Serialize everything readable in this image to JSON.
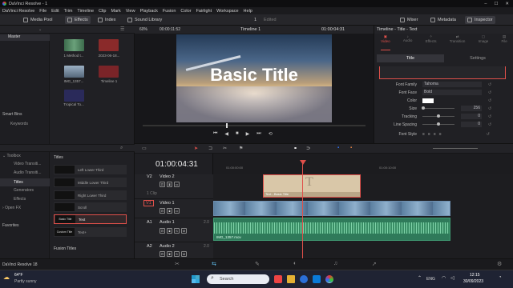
{
  "window": {
    "title": "DaVinci Resolve - 1",
    "controls": [
      "–",
      "☐",
      "✕"
    ]
  },
  "menu": [
    "DaVinci Resolve",
    "File",
    "Edit",
    "Trim",
    "Timeline",
    "Clip",
    "Mark",
    "View",
    "Playback",
    "Fusion",
    "Color",
    "Fairlight",
    "Workspace",
    "Help"
  ],
  "toolbar": {
    "media_pool": "Media Pool",
    "effects": "Effects",
    "index": "Index",
    "sound_library": "Sound Library",
    "project_name": "1",
    "edited": "Edited",
    "mixer": "Mixer",
    "metadata": "Metadata",
    "inspector": "Inspector"
  },
  "media_pool": {
    "bin_master": "Master",
    "smart_bins": "Smart Bins",
    "keywords": "Keywords",
    "clips": [
      {
        "name": "1 Method t...",
        "color": "#3c6b4c"
      },
      {
        "name": "2023-06-18...",
        "color": "#8a2a2a"
      },
      {
        "name": "IMG_1357...",
        "color": "#7a8fa3"
      },
      {
        "name": "Timeline 1",
        "color": "#7a2428"
      },
      {
        "name": "Tropical To...",
        "color": "#2a2a5a"
      }
    ]
  },
  "effects": {
    "categories": [
      "Toolbox",
      "Video Transiti...",
      "Audio Transiti...",
      "Titles",
      "Generators",
      "Effects",
      "Open FX"
    ],
    "favorites": "Favorites",
    "titles_header": "Titles",
    "items": [
      {
        "label": "Left Lower Third",
        "thumb": ""
      },
      {
        "label": "Middle Lower Third",
        "thumb": ""
      },
      {
        "label": "Right Lower Third",
        "thumb": ""
      },
      {
        "label": "Scroll",
        "thumb": ""
      },
      {
        "label": "Text",
        "thumb": "Basic Title"
      },
      {
        "label": "Text+",
        "thumb": "Custom Title"
      }
    ],
    "fusion_titles": "Fusion Titles"
  },
  "viewer": {
    "zoom": "60%",
    "duration": "00:00:11:52",
    "timeline_name": "Timeline 1",
    "timecode": "01:00:04:31",
    "overlay_title": "Basic Title"
  },
  "inspector": {
    "header": "Timeline - Title - Text",
    "tabs": [
      "Video",
      "Audio",
      "Effects",
      "Transition",
      "Image",
      "File"
    ],
    "subtabs": [
      "Title",
      "Settings"
    ],
    "props": [
      {
        "label": "Font Family",
        "value": "Tahoma"
      },
      {
        "label": "Font Face",
        "value": "Bold"
      },
      {
        "label": "Color",
        "value": ""
      },
      {
        "label": "Size",
        "value": "256"
      },
      {
        "label": "Tracking",
        "value": "0"
      },
      {
        "label": "Line Spacing",
        "value": "0"
      },
      {
        "label": "Font Style",
        "value": ""
      }
    ]
  },
  "timeline": {
    "timecode": "01:00:04:31",
    "ruler": [
      "01:00:00:00",
      "01:00:10:00"
    ],
    "tracks": {
      "v2": {
        "id": "V2",
        "name": "Video 2",
        "clips": "1 Clip"
      },
      "v1": {
        "id": "V1",
        "name": "Video 1"
      },
      "a1": {
        "id": "A1",
        "name": "Audio 1",
        "ch": "2.0"
      },
      "a2": {
        "id": "A2",
        "name": "Audio 2",
        "ch": "2.0"
      }
    },
    "text_clip": "Text - Basic Title",
    "audio_clip": "IMG_1357.mov"
  },
  "taskbar": {
    "temperature": "64°F",
    "weather": "Partly sunny",
    "search": "Search",
    "time": "12:15",
    "date": "30/09/2023",
    "lang": "ENG"
  },
  "app_version": "DaVinci Resolve 18"
}
